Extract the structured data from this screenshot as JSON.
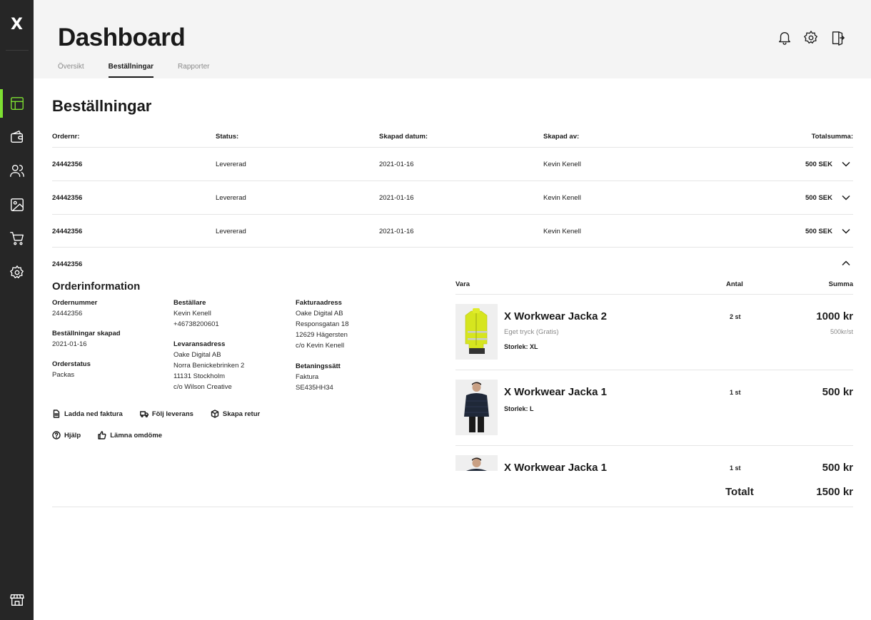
{
  "sidebar": {
    "logo": "X",
    "items": [
      {
        "icon": "layout-icon",
        "active": true
      },
      {
        "icon": "wallet-icon",
        "active": false
      },
      {
        "icon": "users-icon",
        "active": false
      },
      {
        "icon": "image-icon",
        "active": false
      },
      {
        "icon": "cart-icon",
        "active": false
      },
      {
        "icon": "settings-icon",
        "active": false
      }
    ],
    "bottom_icon": "store-icon",
    "accent_color": "#7ee032"
  },
  "header": {
    "title": "Dashboard",
    "tabs": [
      {
        "label": "Översikt",
        "active": false
      },
      {
        "label": "Beställningar",
        "active": true
      },
      {
        "label": "Rapporter",
        "active": false
      }
    ],
    "icons": [
      "bell-icon",
      "gear-icon",
      "logout-icon"
    ]
  },
  "orders": {
    "title": "Beställningar",
    "columns": [
      "Ordernr:",
      "Status:",
      "Skapad datum:",
      "Skapad av:",
      "Totalsumma:"
    ],
    "rows": [
      {
        "ordernr": "24442356",
        "status": "Levererad",
        "date": "2021-01-16",
        "by": "Kevin Kenell",
        "total": "500 SEK"
      },
      {
        "ordernr": "24442356",
        "status": "Levererad",
        "date": "2021-01-16",
        "by": "Kevin Kenell",
        "total": "500 SEK"
      },
      {
        "ordernr": "24442356",
        "status": "Levererad",
        "date": "2021-01-16",
        "by": "Kevin Kenell",
        "total": "500 SEK"
      }
    ]
  },
  "expanded": {
    "ordernr": "24442356",
    "info_title": "Orderinformation",
    "ordernummer_label": "Ordernummer",
    "ordernummer": "24442356",
    "skapad_label": "Beställningar skapad",
    "skapad": "2021-01-16",
    "status_label": "Orderstatus",
    "status": "Packas",
    "bestallare_label": "Beställare",
    "bestallare_name": "Kevin Kenell",
    "bestallare_phone": "+46738200601",
    "leverans_label": "Levaransadress",
    "leverans_lines": [
      "Oake Digital AB",
      "Norra Benickebrinken 2",
      "11131 Stockholm",
      "c/o Wilson Creative"
    ],
    "faktura_label": "Fakturaadress",
    "faktura_lines": [
      "Oake Digital AB",
      "Responsgatan 18",
      "12629 Hägersten",
      "c/o Kevin Kenell"
    ],
    "betalning_label": "Betaningssätt",
    "betalning_lines": [
      "Faktura",
      "SE435HH34"
    ],
    "actions": {
      "download": "Ladda ned faktura",
      "track": "Följ leverans",
      "return": "Skapa retur",
      "help": "Hjälp",
      "review": "Lämna omdöme"
    },
    "products_header": {
      "item": "Vara",
      "qty": "Antal",
      "sum": "Summa"
    },
    "products": [
      {
        "name": "X Workwear Jacka 2",
        "print": "Eget tryck (Gratis)",
        "size": "Storlek: XL",
        "qty": "2 st",
        "sum": "1000 kr",
        "unit": "500kr/st",
        "image": "yellow-hi-vis-jacket"
      },
      {
        "name": "X Workwear Jacka 1",
        "size": "Storlek: L",
        "qty": "1 st",
        "sum": "500 kr",
        "image": "navy-jacket"
      },
      {
        "name": "X Workwear Jacka 1",
        "qty": "1 st",
        "sum": "500 kr",
        "image": "navy-jacket"
      }
    ],
    "total_label": "Totalt",
    "total": "1500 kr"
  }
}
